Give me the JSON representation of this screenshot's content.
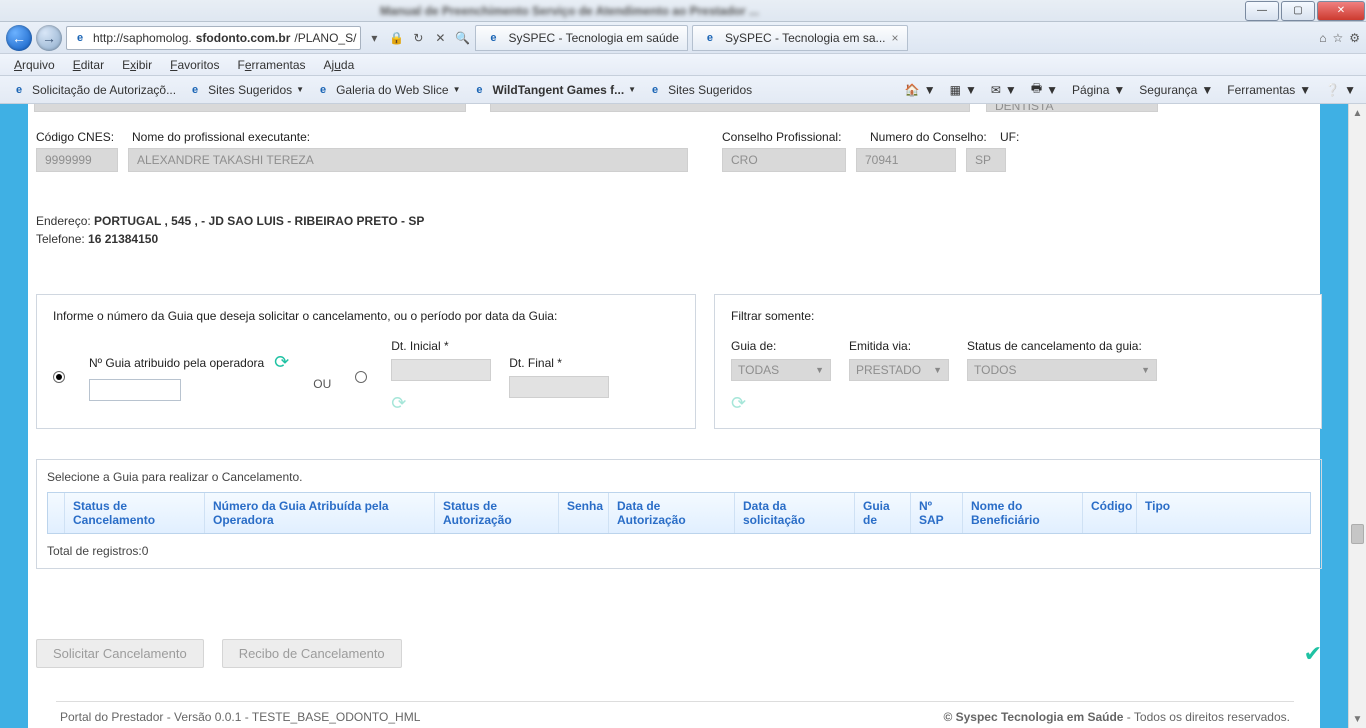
{
  "window": {
    "blurred_title": "Manual de Preenchimento Serviço de Atendimento ao Prestador ..."
  },
  "nav": {
    "url_prefix": "http://saphomolog.",
    "url_domain": "sfodonto.com.br",
    "url_suffix": "/PLANO_S/",
    "tabs": [
      {
        "label": "SySPEC - Tecnologia em saúde"
      },
      {
        "label": "SySPEC - Tecnologia em sa..."
      }
    ]
  },
  "menu": {
    "items": [
      "Arquivo",
      "Editar",
      "Exibir",
      "Favoritos",
      "Ferramentas",
      "Ajuda"
    ],
    "underlines": [
      "A",
      "E",
      "x",
      "F",
      "F",
      "A"
    ]
  },
  "favbar": {
    "items": [
      "Solicitação de Autorizaçõ...",
      "Sites Sugeridos",
      "Galeria do Web Slice",
      "WildTangent Games f...",
      "Sites Sugeridos"
    ],
    "tools": [
      "Página",
      "Segurança",
      "Ferramentas"
    ]
  },
  "professional": {
    "labels": {
      "cnes": "Código CNES:",
      "nome": "Nome do profissional executante:",
      "conselho": "Conselho Profissional:",
      "numero": "Numero do Conselho:",
      "uf": "UF:"
    },
    "values": {
      "cnes": "9999999",
      "nome": "ALEXANDRE TAKASHI TEREZA",
      "conselho": "CRO",
      "numero": "70941",
      "uf": "SP",
      "dentista": "DENTISTA"
    },
    "endereco_label": "Endereço: ",
    "endereco": "PORTUGAL , 545 , - JD SAO LUIS - RIBEIRAO PRETO - SP",
    "telefone_label": "Telefone: ",
    "telefone": "16 21384150"
  },
  "search": {
    "instruction": "Informe o número da Guia que deseja solicitar o cancelamento, ou o período por data da Guia:",
    "guia_label": "Nº Guia atribuido pela operadora",
    "ou": "OU",
    "dt_inicial": "Dt. Inicial *",
    "dt_final": "Dt. Final *"
  },
  "filter": {
    "title": "Filtrar somente:",
    "guia_de_label": "Guia de:",
    "guia_de": "TODAS",
    "emitida_label": "Emitida via:",
    "emitida": "PRESTADO",
    "status_label": "Status de cancelamento da guia:",
    "status": "TODOS"
  },
  "table": {
    "title": "Selecione a Guia para realizar o Cancelamento.",
    "headers": [
      "Status de Cancelamento",
      "Número da Guia Atribuída pela Operadora",
      "Status de Autorização",
      "Senha",
      "Data de Autorização",
      "Data da solicitação",
      "Guia de",
      "Nº SAP",
      "Nome do Beneficiário",
      "Código",
      "Tipo"
    ],
    "total_label": "Total de registros:",
    "total": "0"
  },
  "actions": {
    "solicitar": "Solicitar Cancelamento",
    "recibo": "Recibo de Cancelamento"
  },
  "footer": {
    "left": "Portal do Prestador - Versão 0.0.1 - TESTE_BASE_ODONTO_HML",
    "brand": "© Syspec Tecnologia em Saúde",
    "rights": " - Todos os direitos reservados."
  }
}
